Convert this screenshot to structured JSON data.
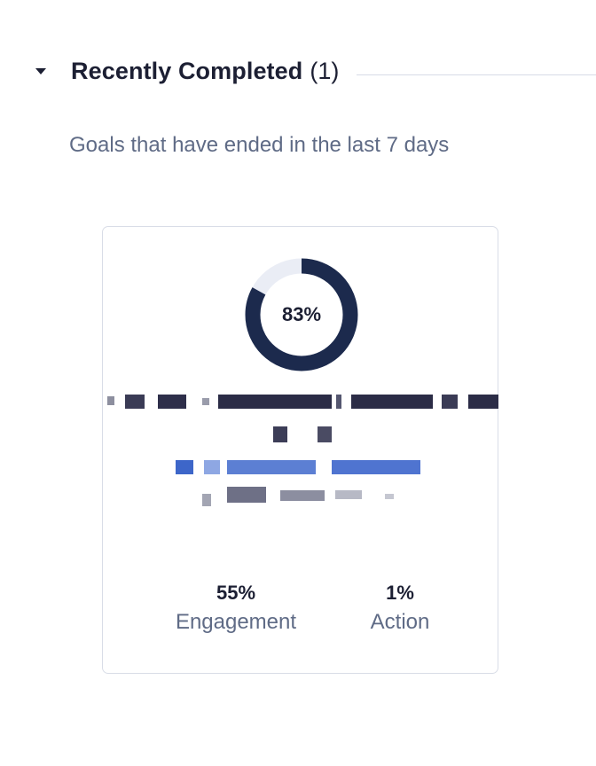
{
  "section": {
    "title": "Recently Completed",
    "count": "(1)",
    "subtitle": "Goals that have ended in the last 7 days"
  },
  "goal_card": {
    "progress_label": "83%",
    "progress_fraction": 0.83,
    "stats": {
      "engagement_value": "55%",
      "engagement_label": "Engagement",
      "action_value": "1%",
      "action_label": "Action"
    }
  },
  "colors": {
    "donut_fill": "#1c2a4d",
    "donut_track": "#eaedf5",
    "text_dark": "#1c1f33",
    "text_muted": "#5f6b86",
    "link": "#2d59c6"
  }
}
